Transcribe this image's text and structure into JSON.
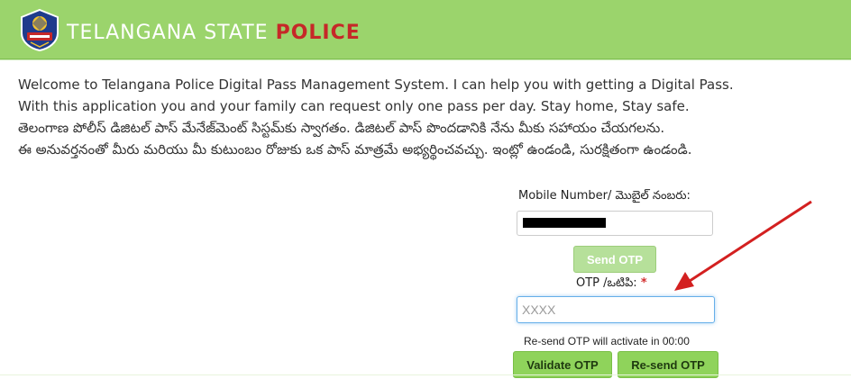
{
  "header": {
    "title_main": "TELANGANA STATE ",
    "title_accent": "POLICE",
    "logo_icon": "telangana-police-badge-icon",
    "bg_color": "#9bd46c",
    "accent_color": "#c62828"
  },
  "intro": {
    "lines": [
      "Welcome to Telangana Police Digital Pass Management System. I can help you with getting a Digital Pass.",
      "With this application you and your family can request only one pass per day. Stay home, Stay safe.",
      "తెలంగాణ పోలీస్ డిజిటల్ పాస్ మేనేజ్‌మెంట్ సిస్టమ్‌కు స్వాగతం. డిజిటల్ పాస్ పొందడానికి నేను మీకు సహాయం చేయగలను.",
      "ఈ అనువర్తనంతో మీరు మరియు మీ కుటుంబం రోజుకు ఒక పాస్ మాత్రమే అభ్యర్థించవచ్చు. ఇంట్లో ఉండండి, సురక్షితంగా ఉండండి."
    ]
  },
  "form": {
    "mobile_label": "Mobile Number/ మొబైల్ నంబరు:",
    "send_otp_label": "Send OTP",
    "otp_label": "OTP /ఒటిపి: ",
    "otp_required_mark": "*",
    "otp_placeholder": "XXXX",
    "resend_note": "Re-send OTP will activate in 00:00",
    "validate_label": "Validate OTP",
    "resend_label": "Re-send OTP"
  },
  "annotation": {
    "arrow_color": "#d32020"
  }
}
